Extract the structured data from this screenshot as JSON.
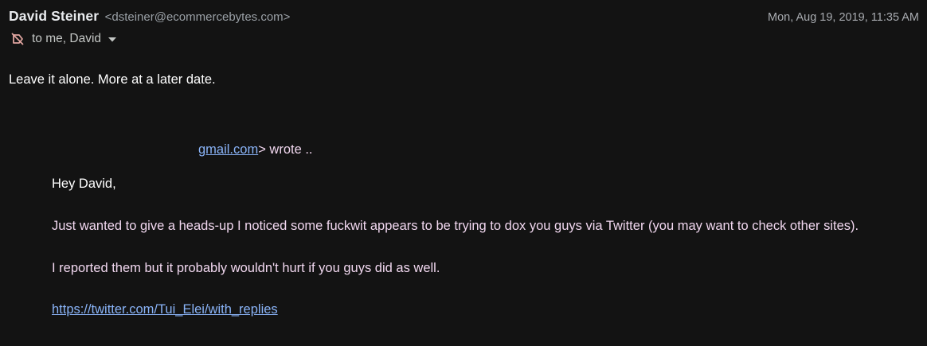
{
  "header": {
    "sender_name": "David Steiner",
    "sender_email": "<dsteiner@ecommercebytes.com>",
    "date": "Mon, Aug 19, 2019, 11:35 AM",
    "recipients": "to me, David",
    "label_icon": "label-off-icon",
    "expand_icon": "chevron-down-icon"
  },
  "message": {
    "reply_text": "Leave it alone. More at a later date."
  },
  "quote": {
    "header_link": "gmail.com",
    "header_suffix": "> wrote ..",
    "greeting": "Hey David,",
    "paragraph1": "Just wanted to give a heads-up I noticed some fuckwit appears to be trying to dox you guys via Twitter (you may want to check other sites).",
    "paragraph2": "I reported them but it probably wouldn't hurt if you guys did as well.",
    "link": "https://twitter.com/Tui_Elei/with_replies"
  },
  "colors": {
    "background": "#131313",
    "quoted_text": "#f1d7ef",
    "link": "#8ab4f8"
  }
}
